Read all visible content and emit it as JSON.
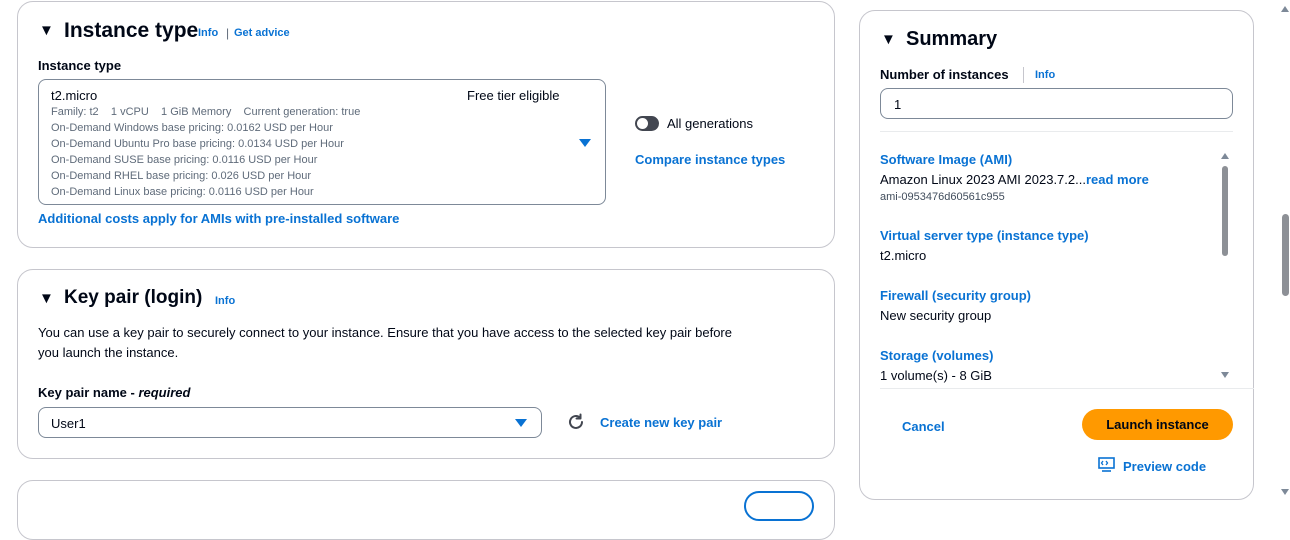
{
  "instance_type_panel": {
    "title": "Instance type",
    "info": "Info",
    "get_advice": "Get advice",
    "field_label": "Instance type",
    "selected": {
      "name": "t2.micro",
      "free_tier": "Free tier eligible",
      "family_line": "Family: t2    1 vCPU    1 GiB Memory    Current generation: true",
      "pricing": [
        "On-Demand Windows base pricing: 0.0162 USD per Hour",
        "On-Demand Ubuntu Pro base pricing: 0.0134 USD per Hour",
        "On-Demand SUSE base pricing: 0.0116 USD per Hour",
        "On-Demand RHEL base pricing: 0.026 USD per Hour",
        "On-Demand Linux base pricing: 0.0116 USD per Hour"
      ]
    },
    "all_generations": "All generations",
    "compare": "Compare instance types",
    "additional_costs": "Additional costs apply for AMIs with pre-installed software"
  },
  "key_pair_panel": {
    "title": "Key pair (login)",
    "info": "Info",
    "description_line1": "You can use a key pair to securely connect to your instance. Ensure that you have access to the selected key pair before",
    "description_line2": "you launch the instance.",
    "field_label": "Key pair name - ",
    "field_required": "required",
    "selected": "User1",
    "create_new": "Create new key pair"
  },
  "summary": {
    "title": "Summary",
    "num_instances_label": "Number of instances",
    "info": "Info",
    "num_instances_value": "1",
    "ami_label": "Software Image (AMI)",
    "ami_value": "Amazon Linux 2023 AMI 2023.7.2...",
    "ami_read_more": "read more",
    "ami_id": "ami-0953476d60561c955",
    "vst_label": "Virtual server type (instance type)",
    "vst_value": "t2.micro",
    "firewall_label": "Firewall (security group)",
    "firewall_value": "New security group",
    "storage_label": "Storage (volumes)",
    "storage_value": "1 volume(s) - 8 GiB",
    "cancel": "Cancel",
    "launch": "Launch instance",
    "preview_code": "Preview code"
  },
  "colors": {
    "link": "#0972d3",
    "primary": "#ff9900",
    "border": "#c6c6cd"
  }
}
